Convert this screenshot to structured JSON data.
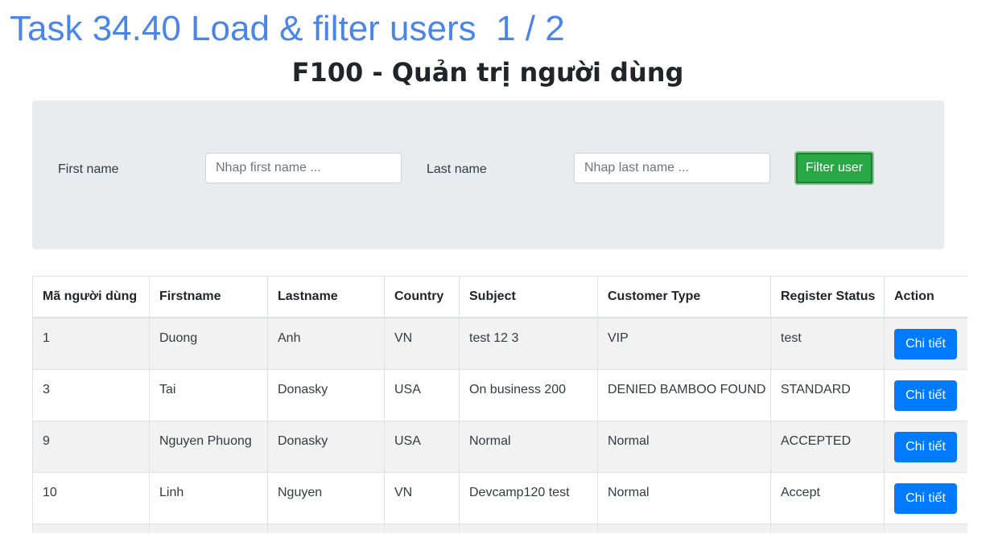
{
  "task_header": "Task 34.40 Load & filter users  1 / 2",
  "page_title": "F100 - Quản trị người dùng",
  "filter": {
    "first_name_label": "First name",
    "first_name_placeholder": "Nhap first name ...",
    "first_name_value": "",
    "last_name_label": "Last name",
    "last_name_placeholder": "Nhap last name ...",
    "last_name_value": "",
    "button_label": "Filter user"
  },
  "table": {
    "headers": [
      "Mã người dùng",
      "Firstname",
      "Lastname",
      "Country",
      "Subject",
      "Customer Type",
      "Register Status",
      "Action"
    ],
    "rows": [
      {
        "id": "1",
        "firstname": "Duong",
        "lastname": "Anh",
        "country": "VN",
        "subject": "test 12 3",
        "customer_type": "VIP",
        "register_status": "test",
        "action": "Chi tiết"
      },
      {
        "id": "3",
        "firstname": "Tai",
        "lastname": "Donasky",
        "country": "USA",
        "subject": "On business 200",
        "customer_type": "DENIED BAMBOO FOUND",
        "register_status": "STANDARD",
        "action": "Chi tiết"
      },
      {
        "id": "9",
        "firstname": "Nguyen Phuong",
        "lastname": "Donasky",
        "country": "USA",
        "subject": "Normal",
        "customer_type": "Normal",
        "register_status": "ACCEPTED",
        "action": "Chi tiết"
      },
      {
        "id": "10",
        "firstname": "Linh",
        "lastname": "Nguyen",
        "country": "VN",
        "subject": "Devcamp120 test",
        "customer_type": "Normal",
        "register_status": "Accept",
        "action": "Chi tiết"
      }
    ]
  },
  "colors": {
    "task_header": "#4a86e8",
    "filter_panel_bg": "#e9ecef",
    "filter_button": "#28a745",
    "detail_button": "#007bff",
    "row_stripe": "#f2f2f2"
  }
}
